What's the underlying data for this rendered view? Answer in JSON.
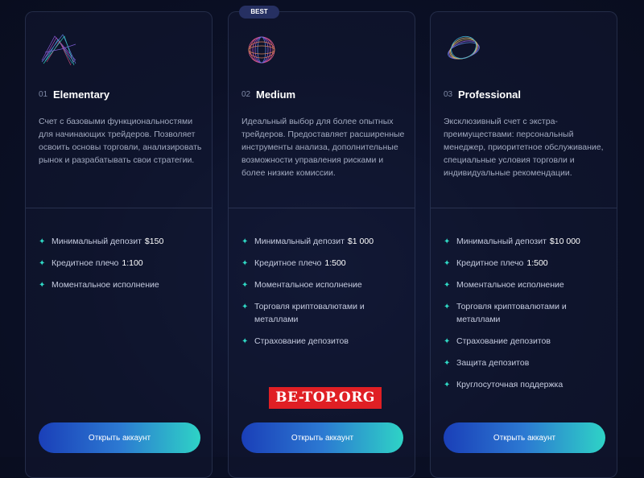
{
  "badge": "BEST",
  "plans": [
    {
      "number": "01",
      "name": "Elementary",
      "description": "Счет с базовыми функциональностями для начинающих трейдеров. Позволяет освоить основы торговли, анализировать рынок и разрабатывать свои стратегии.",
      "logo_icon": "wave-lines-icon",
      "features": [
        {
          "label": "Минимальный депозит",
          "value": "$150"
        },
        {
          "label": "Кредитное плечо",
          "value": "1:100"
        },
        {
          "label": "Моментальное исполнение",
          "value": ""
        }
      ],
      "button": "Открыть аккаунт"
    },
    {
      "number": "02",
      "name": "Medium",
      "description": "Идеальный выбор для более опытных трейдеров. Предоставляет расширенные инструменты анализа, дополнительные возможности управления рисками и более низкие комиссии.",
      "logo_icon": "sphere-lines-icon",
      "features": [
        {
          "label": "Минимальный депозит",
          "value": "$1 000"
        },
        {
          "label": "Кредитное плечо",
          "value": "1:500"
        },
        {
          "label": "Моментальное исполнение",
          "value": ""
        },
        {
          "label": "Торговля криптовалютами и металлами",
          "value": ""
        },
        {
          "label": "Страхование депозитов",
          "value": ""
        }
      ],
      "button": "Открыть аккаунт"
    },
    {
      "number": "03",
      "name": "Professional",
      "description": "Эксклюзивный счет с экстра-преимуществами: персональный менеджер, приоритетное обслуживание, специальные условия торговли и индивидуальные рекомендации.",
      "logo_icon": "ring-lines-icon",
      "features": [
        {
          "label": "Минимальный депозит",
          "value": "$10 000"
        },
        {
          "label": "Кредитное плечо",
          "value": "1:500"
        },
        {
          "label": "Моментальное исполнение",
          "value": ""
        },
        {
          "label": "Торговля криптовалютами и металлами",
          "value": ""
        },
        {
          "label": "Страхование депозитов",
          "value": ""
        },
        {
          "label": "Защита депозитов",
          "value": ""
        },
        {
          "label": "Круглосуточная поддержка",
          "value": ""
        }
      ],
      "button": "Открыть аккаунт"
    }
  ],
  "watermark": "BE-TOP.ORG",
  "colors": {
    "accent": "#2fd8c4",
    "button_start": "#1a3fb8",
    "button_end": "#2ed3c6",
    "watermark_bg": "#e01f24"
  }
}
